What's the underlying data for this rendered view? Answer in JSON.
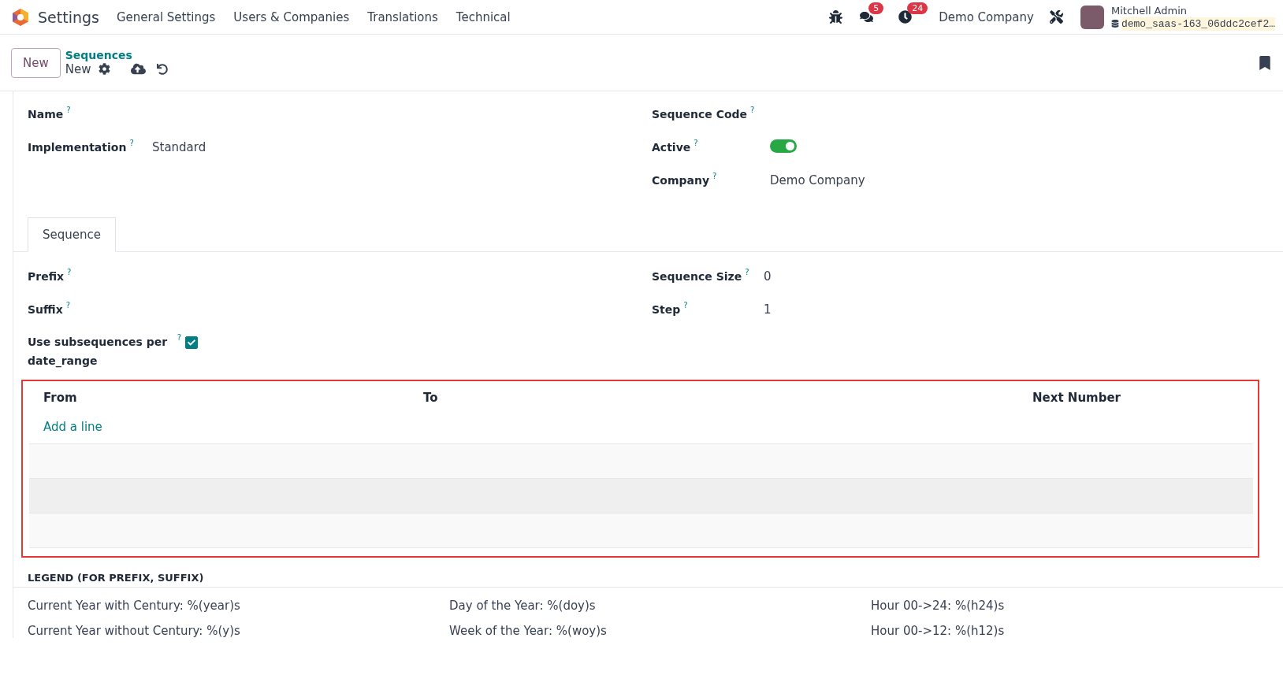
{
  "navbar": {
    "app": "Settings",
    "menu": [
      "General Settings",
      "Users & Companies",
      "Translations",
      "Technical"
    ],
    "messages_count": "5",
    "activities_count": "24",
    "company": "Demo Company",
    "user": "Mitchell Admin",
    "database": "demo_saas-163_06ddc2cef2…"
  },
  "control_panel": {
    "new_button": "New",
    "breadcrumb": "Sequences",
    "record": "New"
  },
  "form": {
    "left": [
      {
        "label": "Name",
        "help": "?"
      },
      {
        "label": "Implementation",
        "help": "?",
        "value": "Standard"
      }
    ],
    "right": [
      {
        "label": "Sequence Code",
        "help": "?",
        "kind": "text"
      },
      {
        "label": "Active",
        "help": "?",
        "kind": "toggle",
        "on": true
      },
      {
        "label": "Company",
        "help": "?",
        "kind": "text",
        "value": "Demo Company"
      }
    ],
    "tabs": [
      {
        "label": "Sequence",
        "selected": true
      }
    ],
    "tab_left": [
      {
        "label": "Prefix",
        "help": "?",
        "kind": "text"
      },
      {
        "label": "Suffix",
        "help": "?",
        "kind": "text"
      },
      {
        "label": "Use subsequences per date_range",
        "help": "?",
        "kind": "checkbox",
        "checked": true
      }
    ],
    "tab_right": [
      {
        "label": "Sequence Size",
        "help": "?",
        "value": "0"
      },
      {
        "label": "Step",
        "help": "?",
        "value": "1"
      }
    ],
    "table": {
      "columns": [
        "From",
        "To",
        "Next Number"
      ],
      "add_line": "Add a line"
    },
    "legend": {
      "title": "LEGEND (FOR PREFIX, SUFFIX)",
      "columns": [
        [
          "Current Year with Century: %(year)s",
          "Current Year without Century: %(y)s"
        ],
        [
          "Day of the Year: %(doy)s",
          "Week of the Year: %(woy)s"
        ],
        [
          "Hour 00->24: %(h24)s",
          "Hour 00->12: %(h12)s"
        ]
      ]
    }
  }
}
